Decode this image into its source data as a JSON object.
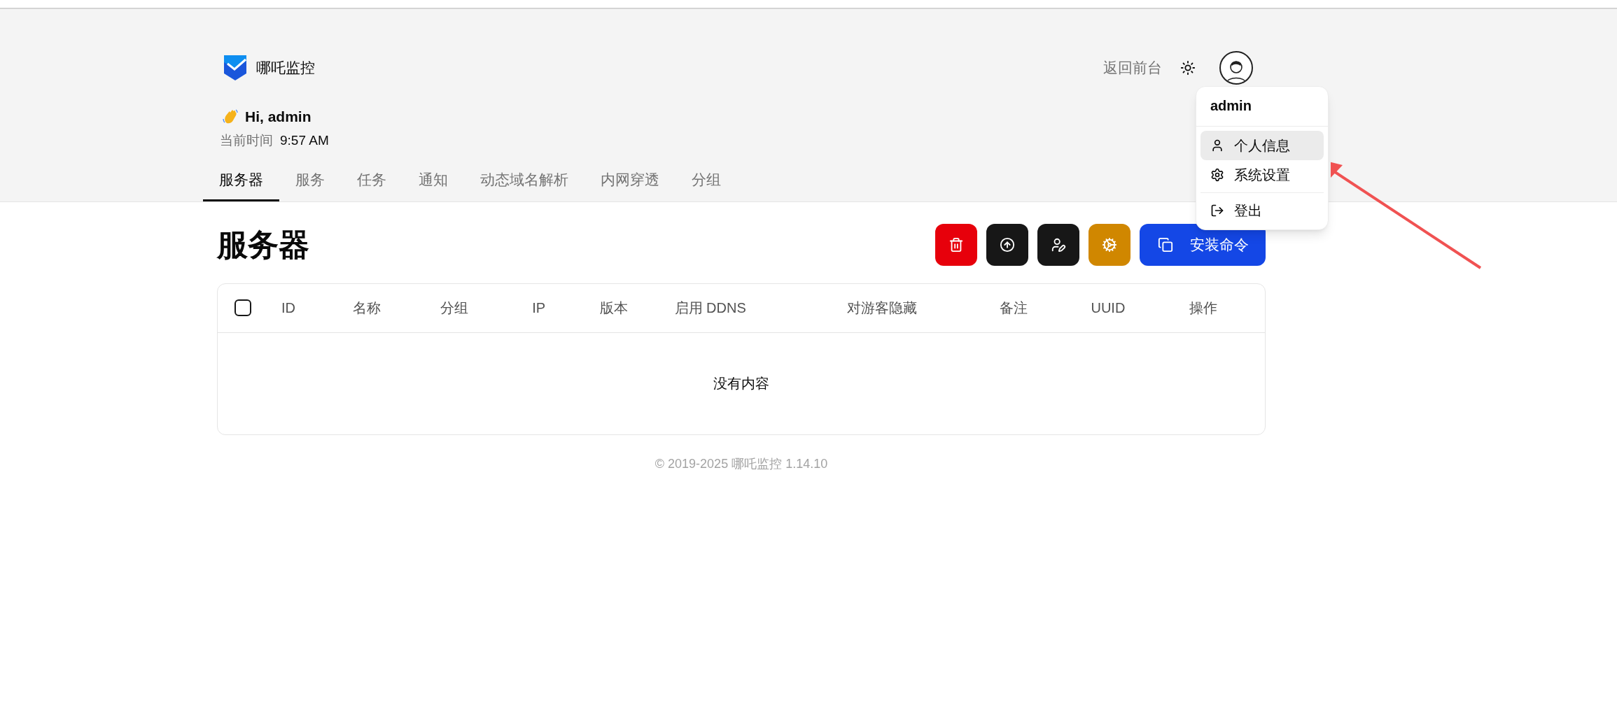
{
  "brand": {
    "name": "哪吒监控"
  },
  "nav": {
    "back_link": "返回前台"
  },
  "greeting": {
    "text": "Hi, admin",
    "time_label": "当前时间",
    "time": "9:57 AM"
  },
  "tabs": [
    {
      "label": "服务器",
      "selected": true
    },
    {
      "label": "服务",
      "selected": false
    },
    {
      "label": "任务",
      "selected": false
    },
    {
      "label": "通知",
      "selected": false
    },
    {
      "label": "动态域名解析",
      "selected": false
    },
    {
      "label": "内网穿透",
      "selected": false
    },
    {
      "label": "分组",
      "selected": false
    }
  ],
  "page": {
    "title": "服务器"
  },
  "toolbar": [
    {
      "kind": "delete"
    },
    {
      "kind": "upgrade"
    },
    {
      "kind": "assign"
    },
    {
      "kind": "task"
    },
    {
      "kind": "install",
      "label": "安装命令"
    }
  ],
  "table": {
    "select_all": {
      "checked": false
    },
    "columns": [
      "ID",
      "名称",
      "分组",
      "IP",
      "版本",
      "启用 DDNS",
      "对游客隐藏",
      "备注",
      "UUID",
      "操作"
    ],
    "empty_text": "没有内容"
  },
  "footer": "© 2019-2025 哪吒监控 1.14.10",
  "user_menu": {
    "username": "admin",
    "items": [
      {
        "kind": "profile",
        "label": "个人信息",
        "selected": true
      },
      {
        "kind": "settings",
        "label": "系统设置",
        "selected": false
      },
      {
        "kind": "logout",
        "label": "登出",
        "selected": false
      }
    ]
  }
}
